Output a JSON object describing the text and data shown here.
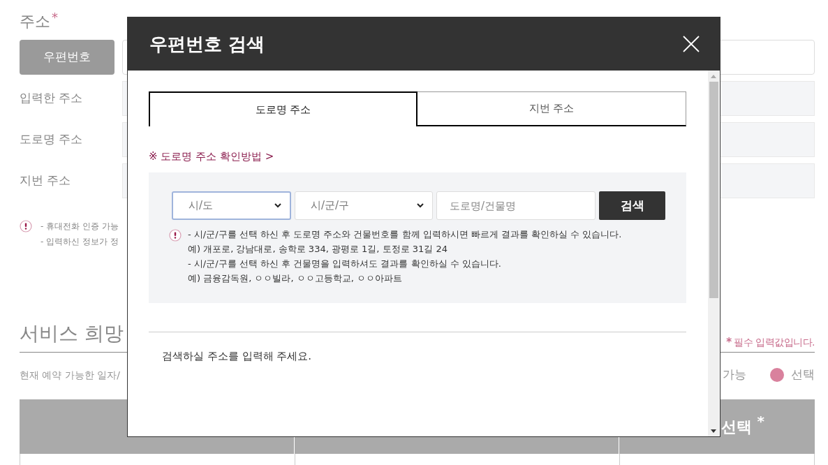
{
  "page": {
    "address_label": "주소",
    "required_mark": "*",
    "postcode_button": "우편번호",
    "rows": [
      {
        "label": "입력한 주소"
      },
      {
        "label": "도로명 주소"
      },
      {
        "label": "지번 주소"
      }
    ],
    "notes": [
      "- 휴대전화 인증 가능",
      "- 입력하신 정보가 정"
    ],
    "section_title": "서비스 희망",
    "required_note_mark": "*",
    "required_note": "필수 입력값입니다.",
    "subtitle": "현재 예약 가능한 일자/",
    "legend": [
      {
        "label": "가능"
      },
      {
        "label": "선택",
        "color": "#d9819d"
      }
    ],
    "table_header": {
      "column_3": "선택",
      "required_mark": "*"
    }
  },
  "modal": {
    "title": "우편번호 검색",
    "tabs": [
      {
        "label": "도로명 주소",
        "selected": true
      },
      {
        "label": "지번 주소",
        "selected": false
      }
    ],
    "guide_link": "※ 도로명 주소 확인방법 >",
    "selects": [
      {
        "value": "시/도",
        "focused": true
      },
      {
        "value": "시/군/구",
        "focused": false
      }
    ],
    "search_field": {
      "placeholder": "도로명/건물명"
    },
    "search_button": "검색",
    "help": [
      "- 시/군/구를 선택 하신 후 도로명 주소와 건물번호를 함께 입력하시면 빠르게 결과를 확인하실 수 있습니다.",
      "예) 개포로, 강남대로, 송학로 334, 광평로 1길, 토정로 31길 24",
      "- 시/군/구를 선택 하신 후 건물명을 입력하셔도 결과를 확인하실 수 있습니다.",
      "예) 금융감독원, ㅇㅇ빌라, ㅇㅇ고등학교, ㅇㅇ아파트"
    ],
    "empty_message": "검색하실 주소를 입력해 주세요."
  }
}
